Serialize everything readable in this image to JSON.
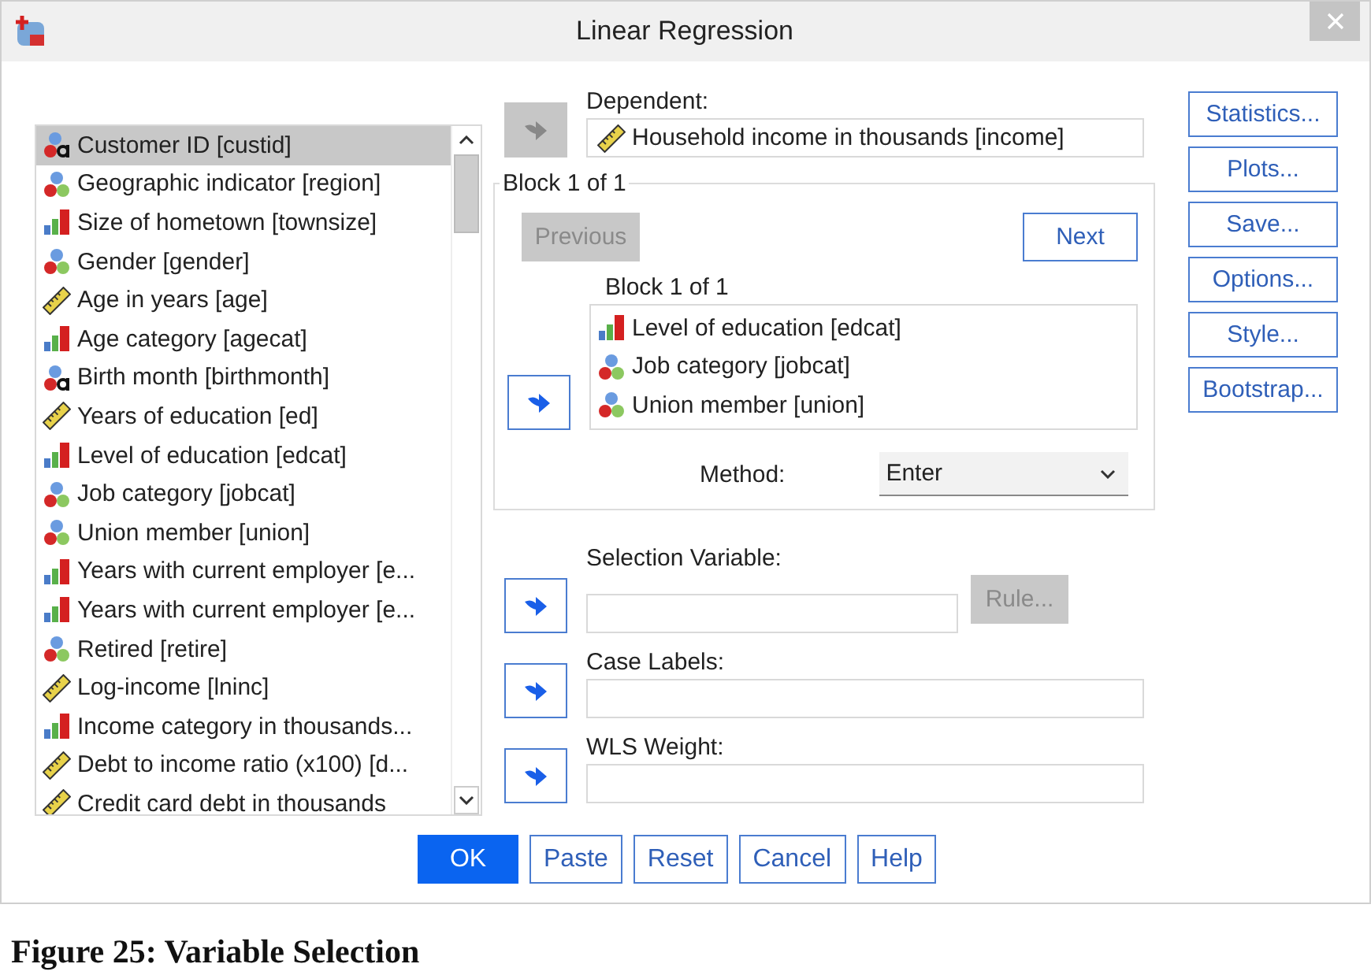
{
  "window": {
    "title": "Linear Regression"
  },
  "variables": [
    {
      "label": "Customer ID [custid]",
      "kind": "nominal_string",
      "selected": true
    },
    {
      "label": "Geographic indicator [region]",
      "kind": "nominal",
      "selected": false
    },
    {
      "label": "Size of hometown [townsize]",
      "kind": "ordinal",
      "selected": false
    },
    {
      "label": "Gender [gender]",
      "kind": "nominal",
      "selected": false
    },
    {
      "label": "Age in years [age]",
      "kind": "scale",
      "selected": false
    },
    {
      "label": "Age category [agecat]",
      "kind": "ordinal",
      "selected": false
    },
    {
      "label": "Birth month [birthmonth]",
      "kind": "nominal_string",
      "selected": false
    },
    {
      "label": "Years of education [ed]",
      "kind": "scale",
      "selected": false
    },
    {
      "label": "Level of education [edcat]",
      "kind": "ordinal",
      "selected": false
    },
    {
      "label": "Job category [jobcat]",
      "kind": "nominal",
      "selected": false
    },
    {
      "label": "Union member [union]",
      "kind": "nominal",
      "selected": false
    },
    {
      "label": "Years with current employer [e...",
      "kind": "ordinal",
      "selected": false
    },
    {
      "label": "Years with current employer [e...",
      "kind": "ordinal",
      "selected": false
    },
    {
      "label": "Retired [retire]",
      "kind": "nominal",
      "selected": false
    },
    {
      "label": "Log-income [lninc]",
      "kind": "scale",
      "selected": false
    },
    {
      "label": "Income category in thousands...",
      "kind": "ordinal",
      "selected": false
    },
    {
      "label": "Debt to income ratio (x100) [d...",
      "kind": "scale",
      "selected": false
    },
    {
      "label": "Credit card debt in thousands",
      "kind": "scale",
      "selected": false
    }
  ],
  "dependent": {
    "label": "Dependent:",
    "arrow_disabled": true,
    "value": {
      "label": "Household income in thousands [income]",
      "kind": "scale"
    }
  },
  "block": {
    "title": "Block 1 of 1",
    "previous": {
      "label": "Previous",
      "disabled": true
    },
    "next": {
      "label": "Next",
      "disabled": false
    },
    "list_title": "Block 1 of 1",
    "arrow_disabled": false,
    "independents": [
      {
        "label": "Level of education [edcat]",
        "kind": "ordinal"
      },
      {
        "label": "Job category [jobcat]",
        "kind": "nominal"
      },
      {
        "label": "Union member [union]",
        "kind": "nominal"
      }
    ],
    "method": {
      "label": "Method:",
      "value": "Enter"
    }
  },
  "selection_variable": {
    "label": "Selection Variable:",
    "arrow_disabled": false,
    "rule": {
      "label": "Rule...",
      "disabled": true
    }
  },
  "case_labels": {
    "label": "Case Labels:",
    "arrow_disabled": false
  },
  "wls_weight": {
    "label": "WLS Weight:",
    "arrow_disabled": false
  },
  "side_buttons": [
    "Statistics...",
    "Plots...",
    "Save...",
    "Options...",
    "Style...",
    "Bootstrap..."
  ],
  "buttons": [
    {
      "label": "OK",
      "primary": true
    },
    {
      "label": "Paste",
      "primary": false
    },
    {
      "label": "Reset",
      "primary": false
    },
    {
      "label": "Cancel",
      "primary": false
    },
    {
      "label": "Help",
      "primary": false
    }
  ],
  "caption": "Figure 25: Variable Selection"
}
